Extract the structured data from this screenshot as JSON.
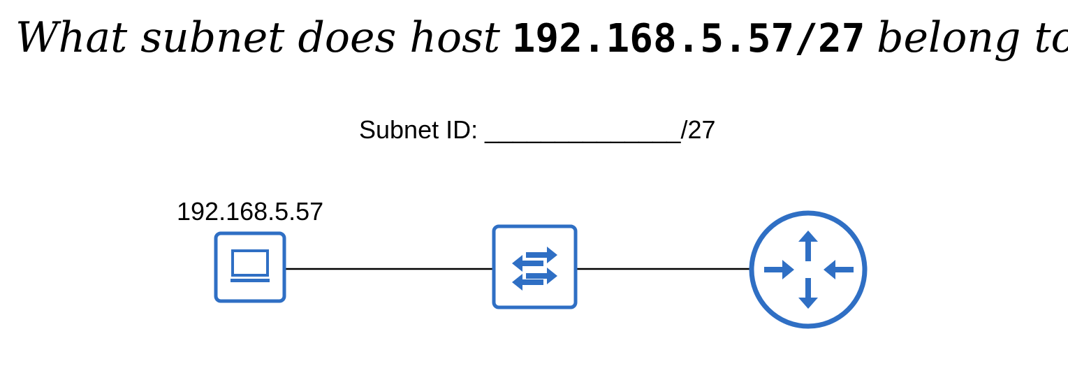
{
  "question": {
    "prefix": "What subnet does host",
    "address": "192.168.5.57/27",
    "suffix": "belong to?"
  },
  "subnet_prompt": {
    "label": "Subnet ID:",
    "blank": "______________",
    "suffix": "/27"
  },
  "nodes": {
    "host": {
      "label": "192.168.5.57",
      "icon": "pc-icon"
    },
    "switch": {
      "icon": "switch-icon"
    },
    "router": {
      "icon": "router-icon"
    }
  },
  "colors": {
    "device": "#2f6fc4",
    "link": "#000000",
    "background": "#ffffff"
  }
}
